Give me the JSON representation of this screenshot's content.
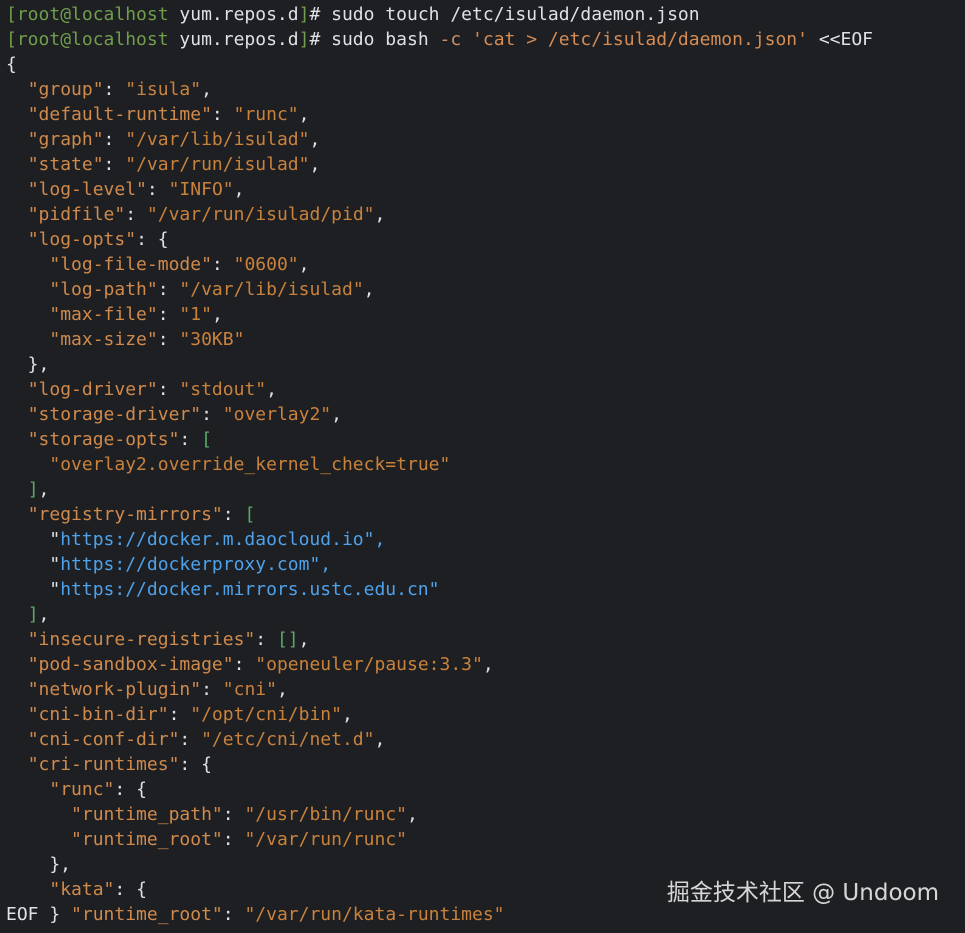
{
  "colors": {
    "background": "#1e1f22",
    "text": "#dfe1e5",
    "prompt_bracket": "#6f9e4c",
    "json_key": "#d08a4c",
    "json_string": "#c9823c",
    "url": "#4ea2ec",
    "array_bracket": "#59a869"
  },
  "terminal": {
    "lines": [
      [
        {
          "t": "[",
          "c": "bracket-prompt"
        },
        {
          "t": "root@localhost",
          "c": "bracket-prompt"
        },
        {
          "t": " yum.repos.d",
          "c": "default"
        },
        {
          "t": "]",
          "c": "bracket-prompt"
        },
        {
          "t": "# sudo touch /etc/isulad/daemon.json",
          "c": "default"
        }
      ],
      [
        {
          "t": "[",
          "c": "bracket-prompt"
        },
        {
          "t": "root@localhost",
          "c": "bracket-prompt"
        },
        {
          "t": " yum.repos.d",
          "c": "default"
        },
        {
          "t": "]",
          "c": "bracket-prompt"
        },
        {
          "t": "# sudo bash ",
          "c": "default"
        },
        {
          "t": "-c",
          "c": "flag"
        },
        {
          "t": " ",
          "c": "default"
        },
        {
          "t": "'cat > /etc/isulad/daemon.json'",
          "c": "quoted"
        },
        {
          "t": " <<EOF",
          "c": "default"
        }
      ],
      [
        {
          "t": "{",
          "c": "default"
        }
      ],
      [
        {
          "t": "  ",
          "c": "default"
        },
        {
          "t": "\"group\"",
          "c": "key"
        },
        {
          "t": ": ",
          "c": "default"
        },
        {
          "t": "\"isula\"",
          "c": "str"
        },
        {
          "t": ",",
          "c": "default"
        }
      ],
      [
        {
          "t": "  ",
          "c": "default"
        },
        {
          "t": "\"default-runtime\"",
          "c": "key"
        },
        {
          "t": ": ",
          "c": "default"
        },
        {
          "t": "\"runc\"",
          "c": "str"
        },
        {
          "t": ",",
          "c": "default"
        }
      ],
      [
        {
          "t": "  ",
          "c": "default"
        },
        {
          "t": "\"graph\"",
          "c": "key"
        },
        {
          "t": ": ",
          "c": "default"
        },
        {
          "t": "\"/var/lib/isulad\"",
          "c": "str"
        },
        {
          "t": ",",
          "c": "default"
        }
      ],
      [
        {
          "t": "  ",
          "c": "default"
        },
        {
          "t": "\"state\"",
          "c": "key"
        },
        {
          "t": ": ",
          "c": "default"
        },
        {
          "t": "\"/var/run/isulad\"",
          "c": "str"
        },
        {
          "t": ",",
          "c": "default"
        }
      ],
      [
        {
          "t": "  ",
          "c": "default"
        },
        {
          "t": "\"log-level\"",
          "c": "key"
        },
        {
          "t": ": ",
          "c": "default"
        },
        {
          "t": "\"INFO\"",
          "c": "str"
        },
        {
          "t": ",",
          "c": "default"
        }
      ],
      [
        {
          "t": "  ",
          "c": "default"
        },
        {
          "t": "\"pidfile\"",
          "c": "key"
        },
        {
          "t": ": ",
          "c": "default"
        },
        {
          "t": "\"/var/run/isulad/pid\"",
          "c": "str"
        },
        {
          "t": ",",
          "c": "default"
        }
      ],
      [
        {
          "t": "  ",
          "c": "default"
        },
        {
          "t": "\"log-opts\"",
          "c": "key"
        },
        {
          "t": ": {",
          "c": "default"
        }
      ],
      [
        {
          "t": "    ",
          "c": "default"
        },
        {
          "t": "\"log-file-mode\"",
          "c": "key"
        },
        {
          "t": ": ",
          "c": "default"
        },
        {
          "t": "\"0600\"",
          "c": "str"
        },
        {
          "t": ",",
          "c": "default"
        }
      ],
      [
        {
          "t": "    ",
          "c": "default"
        },
        {
          "t": "\"log-path\"",
          "c": "key"
        },
        {
          "t": ": ",
          "c": "default"
        },
        {
          "t": "\"/var/lib/isulad\"",
          "c": "str"
        },
        {
          "t": ",",
          "c": "default"
        }
      ],
      [
        {
          "t": "    ",
          "c": "default"
        },
        {
          "t": "\"max-file\"",
          "c": "key"
        },
        {
          "t": ": ",
          "c": "default"
        },
        {
          "t": "\"1\"",
          "c": "str"
        },
        {
          "t": ",",
          "c": "default"
        }
      ],
      [
        {
          "t": "    ",
          "c": "default"
        },
        {
          "t": "\"max-size\"",
          "c": "key"
        },
        {
          "t": ": ",
          "c": "default"
        },
        {
          "t": "\"30KB\"",
          "c": "str"
        }
      ],
      [
        {
          "t": "  },",
          "c": "default"
        }
      ],
      [
        {
          "t": "  ",
          "c": "default"
        },
        {
          "t": "\"log-driver\"",
          "c": "key"
        },
        {
          "t": ": ",
          "c": "default"
        },
        {
          "t": "\"stdout\"",
          "c": "str"
        },
        {
          "t": ",",
          "c": "default"
        }
      ],
      [
        {
          "t": "  ",
          "c": "default"
        },
        {
          "t": "\"storage-driver\"",
          "c": "key"
        },
        {
          "t": ": ",
          "c": "default"
        },
        {
          "t": "\"overlay2\"",
          "c": "str"
        },
        {
          "t": ",",
          "c": "default"
        }
      ],
      [
        {
          "t": "  ",
          "c": "default"
        },
        {
          "t": "\"storage-opts\"",
          "c": "key"
        },
        {
          "t": ": ",
          "c": "default"
        },
        {
          "t": "[",
          "c": "green"
        }
      ],
      [
        {
          "t": "    ",
          "c": "default"
        },
        {
          "t": "\"overlay2.override_kernel_check=true\"",
          "c": "str"
        }
      ],
      [
        {
          "t": "  ",
          "c": "default"
        },
        {
          "t": "]",
          "c": "green"
        },
        {
          "t": ",",
          "c": "default"
        }
      ],
      [
        {
          "t": "  ",
          "c": "default"
        },
        {
          "t": "\"registry-mirrors\"",
          "c": "key"
        },
        {
          "t": ": ",
          "c": "default"
        },
        {
          "t": "[",
          "c": "green"
        }
      ],
      [
        {
          "t": "    \"",
          "c": "default"
        },
        {
          "t": "https://docker.m.daocloud.io",
          "c": "url"
        },
        {
          "t": "\",",
          "c": "url"
        }
      ],
      [
        {
          "t": "    \"",
          "c": "default"
        },
        {
          "t": "https://dockerproxy.com",
          "c": "url"
        },
        {
          "t": "\",",
          "c": "url"
        }
      ],
      [
        {
          "t": "    \"",
          "c": "default"
        },
        {
          "t": "https://docker.mirrors.ustc.edu.cn",
          "c": "url"
        },
        {
          "t": "\"",
          "c": "url"
        }
      ],
      [
        {
          "t": "  ",
          "c": "default"
        },
        {
          "t": "]",
          "c": "green"
        },
        {
          "t": ",",
          "c": "default"
        }
      ],
      [
        {
          "t": "  ",
          "c": "default"
        },
        {
          "t": "\"insecure-registries\"",
          "c": "key"
        },
        {
          "t": ": ",
          "c": "default"
        },
        {
          "t": "[]",
          "c": "green"
        },
        {
          "t": ",",
          "c": "default"
        }
      ],
      [
        {
          "t": "  ",
          "c": "default"
        },
        {
          "t": "\"pod-sandbox-image\"",
          "c": "key"
        },
        {
          "t": ": ",
          "c": "default"
        },
        {
          "t": "\"openeuler/pause:3.3\"",
          "c": "str"
        },
        {
          "t": ",",
          "c": "default"
        }
      ],
      [
        {
          "t": "  ",
          "c": "default"
        },
        {
          "t": "\"network-plugin\"",
          "c": "key"
        },
        {
          "t": ": ",
          "c": "default"
        },
        {
          "t": "\"cni\"",
          "c": "str"
        },
        {
          "t": ",",
          "c": "default"
        }
      ],
      [
        {
          "t": "  ",
          "c": "default"
        },
        {
          "t": "\"cni-bin-dir\"",
          "c": "key"
        },
        {
          "t": ": ",
          "c": "default"
        },
        {
          "t": "\"/opt/cni/bin\"",
          "c": "str"
        },
        {
          "t": ",",
          "c": "default"
        }
      ],
      [
        {
          "t": "  ",
          "c": "default"
        },
        {
          "t": "\"cni-conf-dir\"",
          "c": "key"
        },
        {
          "t": ": ",
          "c": "default"
        },
        {
          "t": "\"/etc/cni/net.d\"",
          "c": "str"
        },
        {
          "t": ",",
          "c": "default"
        }
      ],
      [
        {
          "t": "  ",
          "c": "default"
        },
        {
          "t": "\"cri-runtimes\"",
          "c": "key"
        },
        {
          "t": ": {",
          "c": "default"
        }
      ],
      [
        {
          "t": "    ",
          "c": "default"
        },
        {
          "t": "\"runc\"",
          "c": "key"
        },
        {
          "t": ": {",
          "c": "default"
        }
      ],
      [
        {
          "t": "      ",
          "c": "default"
        },
        {
          "t": "\"runtime_path\"",
          "c": "key"
        },
        {
          "t": ": ",
          "c": "default"
        },
        {
          "t": "\"/usr/bin/runc\"",
          "c": "str"
        },
        {
          "t": ",",
          "c": "default"
        }
      ],
      [
        {
          "t": "      ",
          "c": "default"
        },
        {
          "t": "\"runtime_root\"",
          "c": "key"
        },
        {
          "t": ": ",
          "c": "default"
        },
        {
          "t": "\"/var/run/runc\"",
          "c": "str"
        }
      ],
      [
        {
          "t": "    },",
          "c": "default"
        }
      ],
      [
        {
          "t": "    ",
          "c": "default"
        },
        {
          "t": "\"kata\"",
          "c": "key"
        },
        {
          "t": ": {",
          "c": "default"
        }
      ],
      [
        {
          "t": "EOF } ",
          "c": "default"
        },
        {
          "t": "\"runtime_root\"",
          "c": "key"
        },
        {
          "t": ": ",
          "c": "default"
        },
        {
          "t": "\"/var/run/kata-runtimes\"",
          "c": "str"
        }
      ]
    ]
  },
  "watermark": {
    "text": "掘金技术社区 @ Undoom"
  }
}
